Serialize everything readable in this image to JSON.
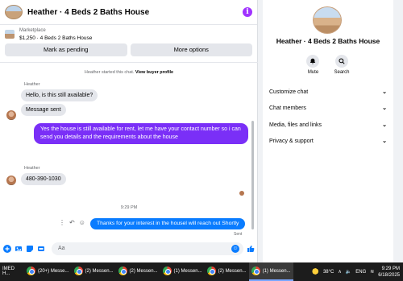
{
  "header": {
    "title": "Heather · 4 Beds 2 Baths House",
    "info_icon": "info-icon",
    "info_glyph": "i"
  },
  "marketplace": {
    "label": "Marketplace",
    "listing": "$1,250 · 4 Beds 2 Baths House"
  },
  "actions": {
    "mark_pending": "Mark as pending",
    "more_options": "More options"
  },
  "system": {
    "started": "Heather started this chat.",
    "view_profile": "View buyer profile"
  },
  "messages": [
    {
      "sender": "Heather",
      "text": "Hello, is this still available?"
    },
    {
      "sender": "",
      "text": "Message sent"
    },
    {
      "sender": "me",
      "text": "Yes the house is still available for rent, let me have your contact number so i can send you details and the requirements about the house"
    },
    {
      "sender": "Heather",
      "text": "480-390-1030"
    },
    {
      "sender": "me",
      "text": "Thanks for your interest in the housel will reach out Shortly"
    }
  ],
  "timestamp": "9:29 PM",
  "sent_status": "Sent",
  "composer": {
    "placeholder": "Aa"
  },
  "info_panel": {
    "title": "Heather · 4 Beds 2 Baths House",
    "mute": "Mute",
    "search": "Search",
    "rows": [
      "Customize chat",
      "Chat members",
      "Media, files and links",
      "Privacy & support"
    ]
  },
  "taskbar": {
    "items": [
      "IMED H...",
      "(20+) Messe...",
      "(2) Messen...",
      "(2) Messen...",
      "(1) Messen...",
      "(2) Messen...",
      "(1) Messen..."
    ],
    "temperature": "38°C",
    "language": "ENG",
    "time": "9:29 PM",
    "date": "6/18/2025"
  },
  "colors": {
    "outgoing_purple": "#7a2ff7",
    "outgoing_blue": "#0a7cff",
    "incoming_gray": "#e4e6eb",
    "info_accent": "#a033ff"
  }
}
